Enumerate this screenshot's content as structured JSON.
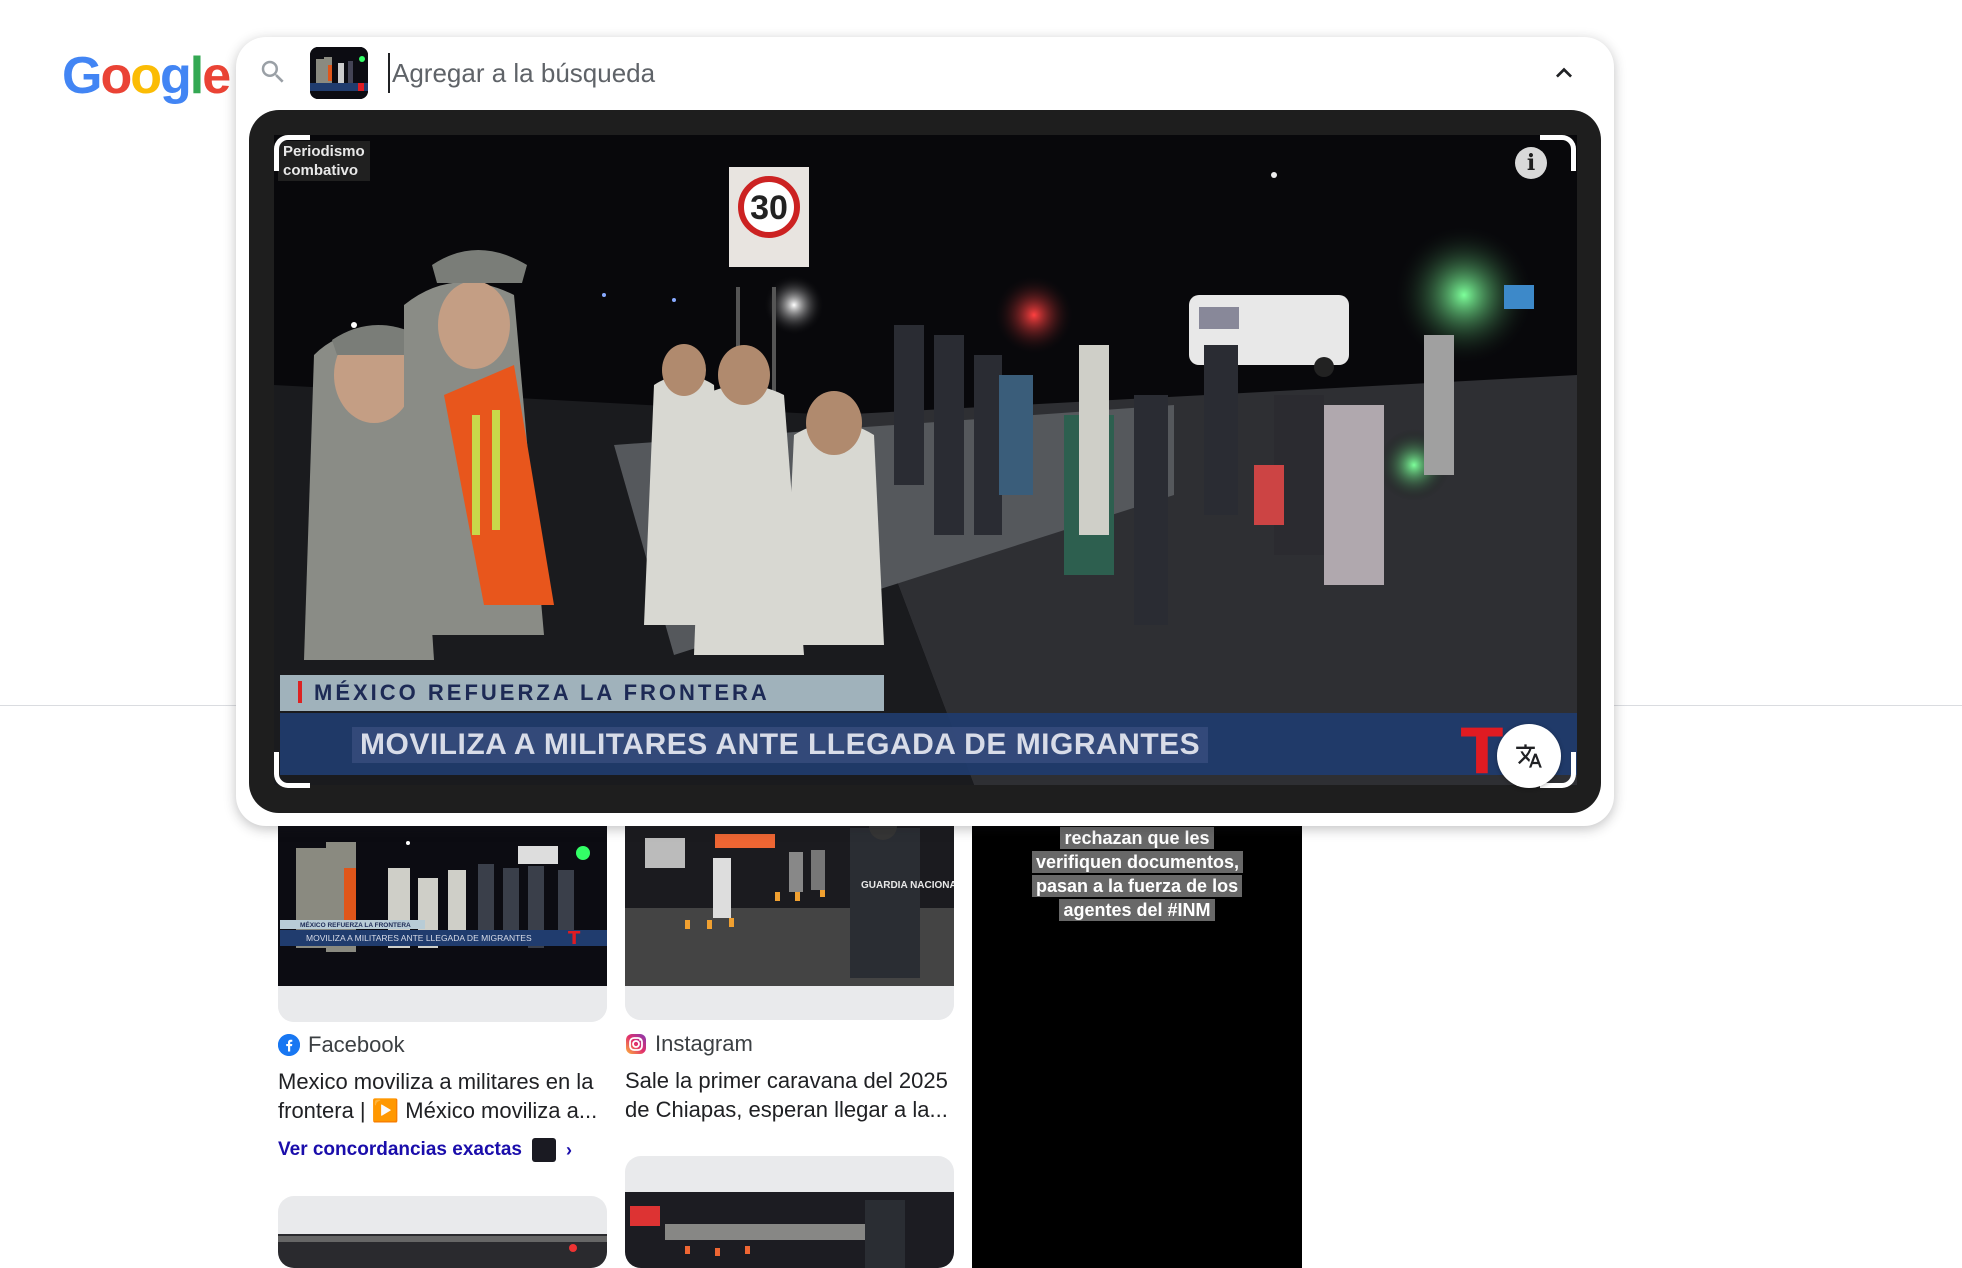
{
  "logo": {
    "letters": [
      "G",
      "o",
      "o",
      "g",
      "l",
      "e"
    ],
    "colors": [
      "#4285F4",
      "#EA4335",
      "#FBBC05",
      "#4285F4",
      "#34A853",
      "#EA4335"
    ]
  },
  "search": {
    "placeholder": "Agregar a la búsqueda",
    "value": "",
    "icons": {
      "search": "search-icon",
      "collapse": "chevron-up-icon"
    }
  },
  "lens": {
    "channel_tag": "Periodismo\ncombativo",
    "info_icon": "info-icon",
    "speed_sign": "30",
    "lower_third_top": "MÉXICO REFUERZA LA FRONTERA",
    "lower_third_headline": "MOVILIZA A MILITARES ANTE LLEGADA DE MIGRANTES",
    "network_logo": "T",
    "translate_icon": "translate-icon"
  },
  "results": {
    "col1": {
      "thumb_top": "MÉXICO REFUERZA LA FRONTERA",
      "thumb_headline": "MOVILIZA A MILITARES ANTE LLEGADA DE MIGRANTES",
      "source": "Facebook",
      "title": "Mexico moviliza a militares en la frontera | ▶️ México moviliza a...",
      "exact_matches": "Ver concordancias exactas"
    },
    "col2": {
      "thumb_vest": "GUARDIA NACIONAL",
      "source": "Instagram",
      "title": "Sale la primer caravana del 2025 de Chiapas, esperan llegar a la..."
    },
    "col3": {
      "caption": "rechazan que les verifiquen documentos, pasan a la fuerza de los agentes del #INM"
    }
  },
  "colors": {
    "facebook": "#1877F2",
    "link": "#1a0dab",
    "network": "#e01b22"
  }
}
